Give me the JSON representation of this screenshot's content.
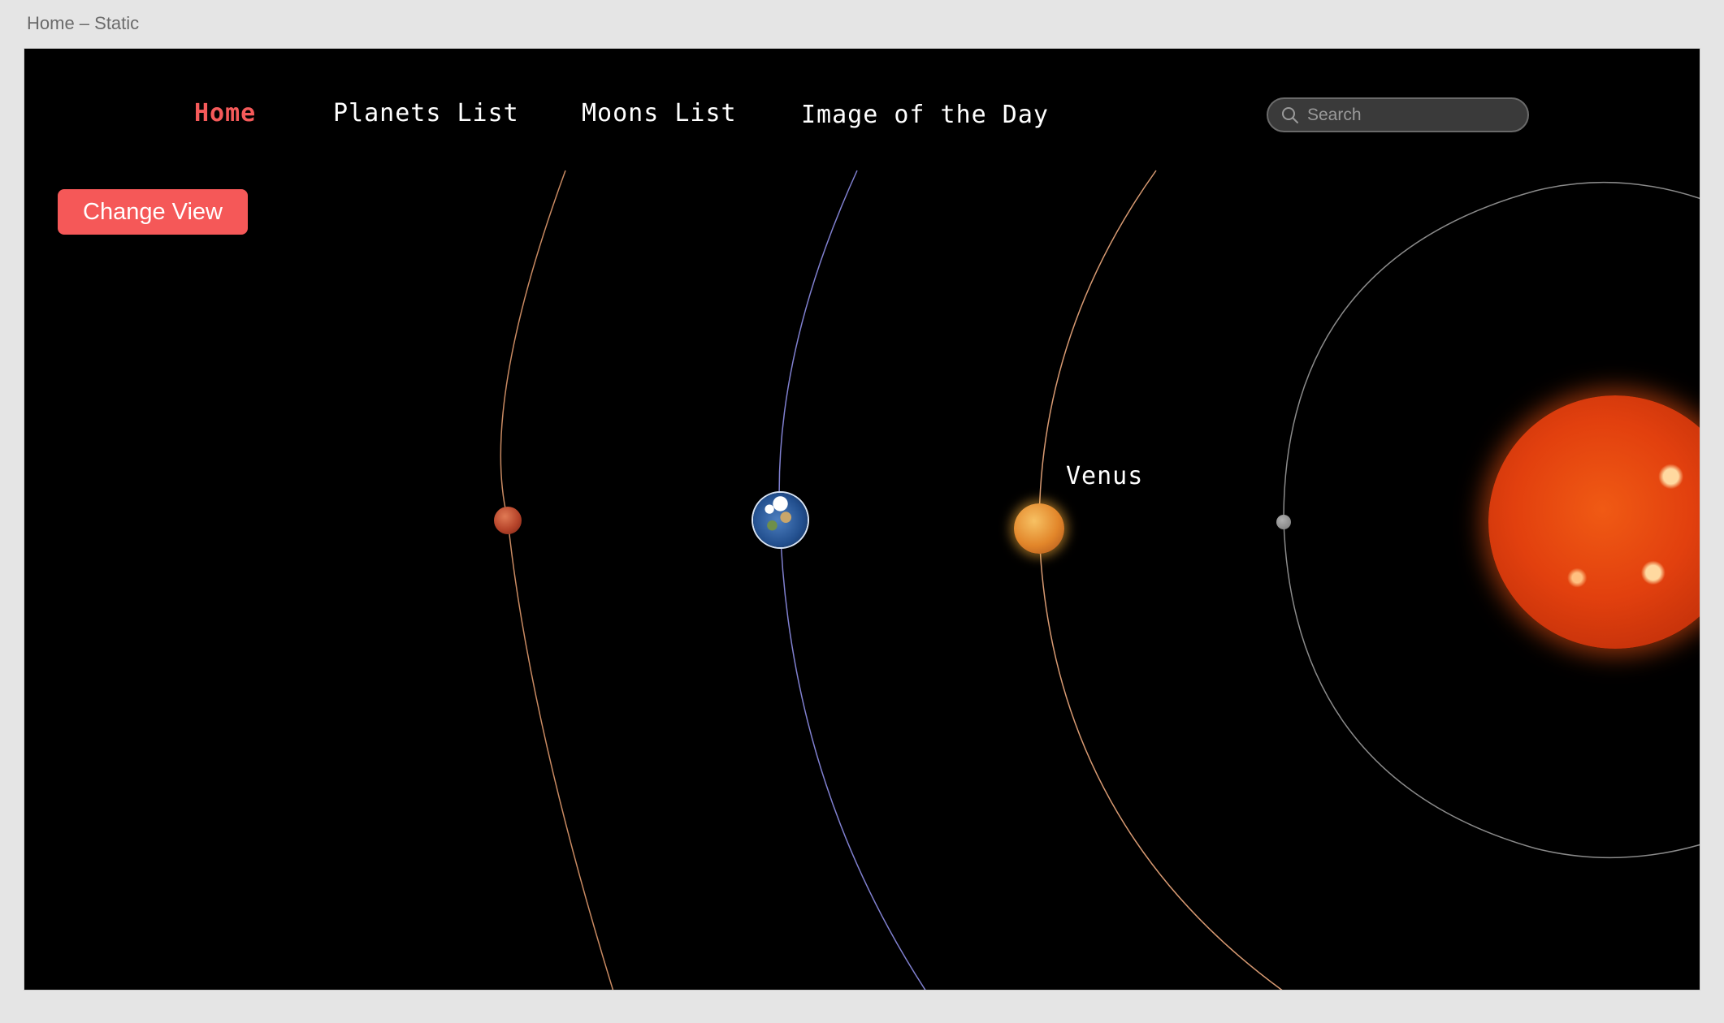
{
  "window": {
    "title": "Home – Static"
  },
  "nav": {
    "items": [
      {
        "label": "Home",
        "active": true
      },
      {
        "label": "Planets List",
        "active": false
      },
      {
        "label": "Moons List",
        "active": false
      },
      {
        "label": "Image of the Day",
        "active": false
      }
    ],
    "accent_color": "#f55a5a"
  },
  "search": {
    "placeholder": "Search",
    "value": "",
    "icon": "search-icon"
  },
  "actions": {
    "change_view_label": "Change View",
    "button_color": "#f55858"
  },
  "solar_system": {
    "planets": [
      {
        "name": "Mars",
        "color": "#b6442a",
        "orbit_color": "#c98a62"
      },
      {
        "name": "Earth",
        "color": "#23508f",
        "orbit_color": "#8080d0"
      },
      {
        "name": "Venus",
        "color": "#e2862a",
        "orbit_color": "#d89a72"
      },
      {
        "name": "Mercury",
        "color": "#7a7a7a",
        "orbit_color": "#8a8a8a"
      }
    ],
    "star": {
      "name": "Sun",
      "color": "#e2400e"
    },
    "label_shown": "Venus"
  }
}
